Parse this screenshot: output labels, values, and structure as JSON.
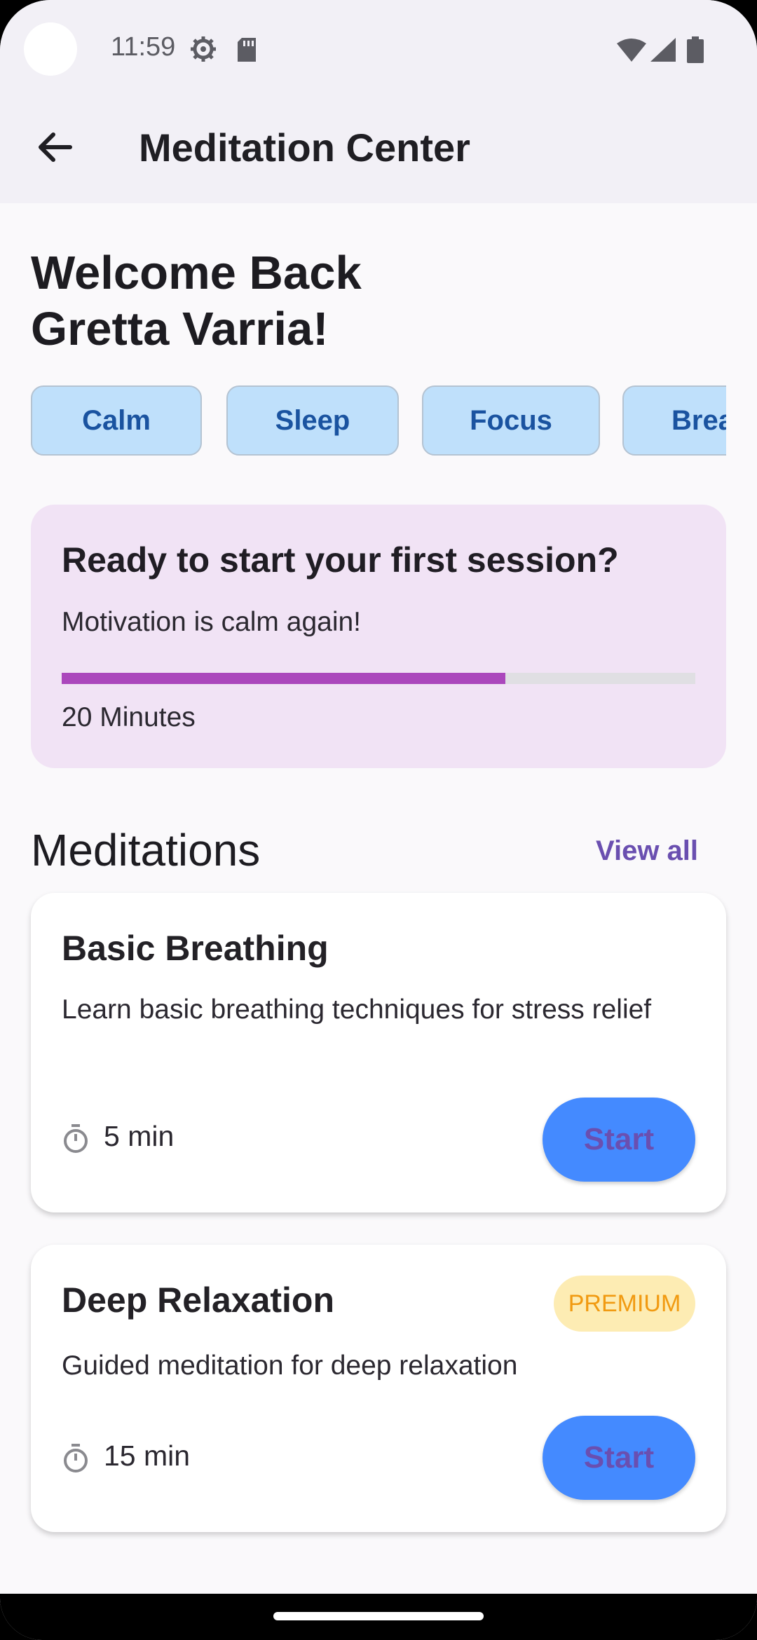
{
  "status_bar": {
    "time": "11:59",
    "icons": [
      "gear-icon",
      "sd-card-icon",
      "wifi-icon",
      "cell-signal-icon",
      "battery-icon"
    ]
  },
  "app_bar": {
    "title": "Meditation Center",
    "back_icon": "arrow-back-icon"
  },
  "welcome": {
    "line1": "Welcome Back",
    "line2": "Gretta Varria!"
  },
  "chips": [
    "Calm",
    "Sleep",
    "Focus",
    "Breathe"
  ],
  "session_card": {
    "title": "Ready to start your first session?",
    "subtitle": "Motivation is calm again!",
    "progress": 0.7,
    "duration": "20 Minutes",
    "progress_color": "#ab47bc"
  },
  "meditations": {
    "section_title": "Meditations",
    "view_all": "View all",
    "items": [
      {
        "title": "Basic Breathing",
        "description": "Learn basic breathing techniques for stress relief",
        "duration": "5 min",
        "button": "Start",
        "badge": ""
      },
      {
        "title": "Deep Relaxation",
        "description": "Guided meditation for deep relaxation",
        "duration": "15 min",
        "button": "Start",
        "badge": "PREMIUM"
      }
    ]
  },
  "colors": {
    "accent": "#6a4fb0",
    "button": "#448aff",
    "chip_bg": "#bfe0fb",
    "premium_text": "#f19a11"
  }
}
